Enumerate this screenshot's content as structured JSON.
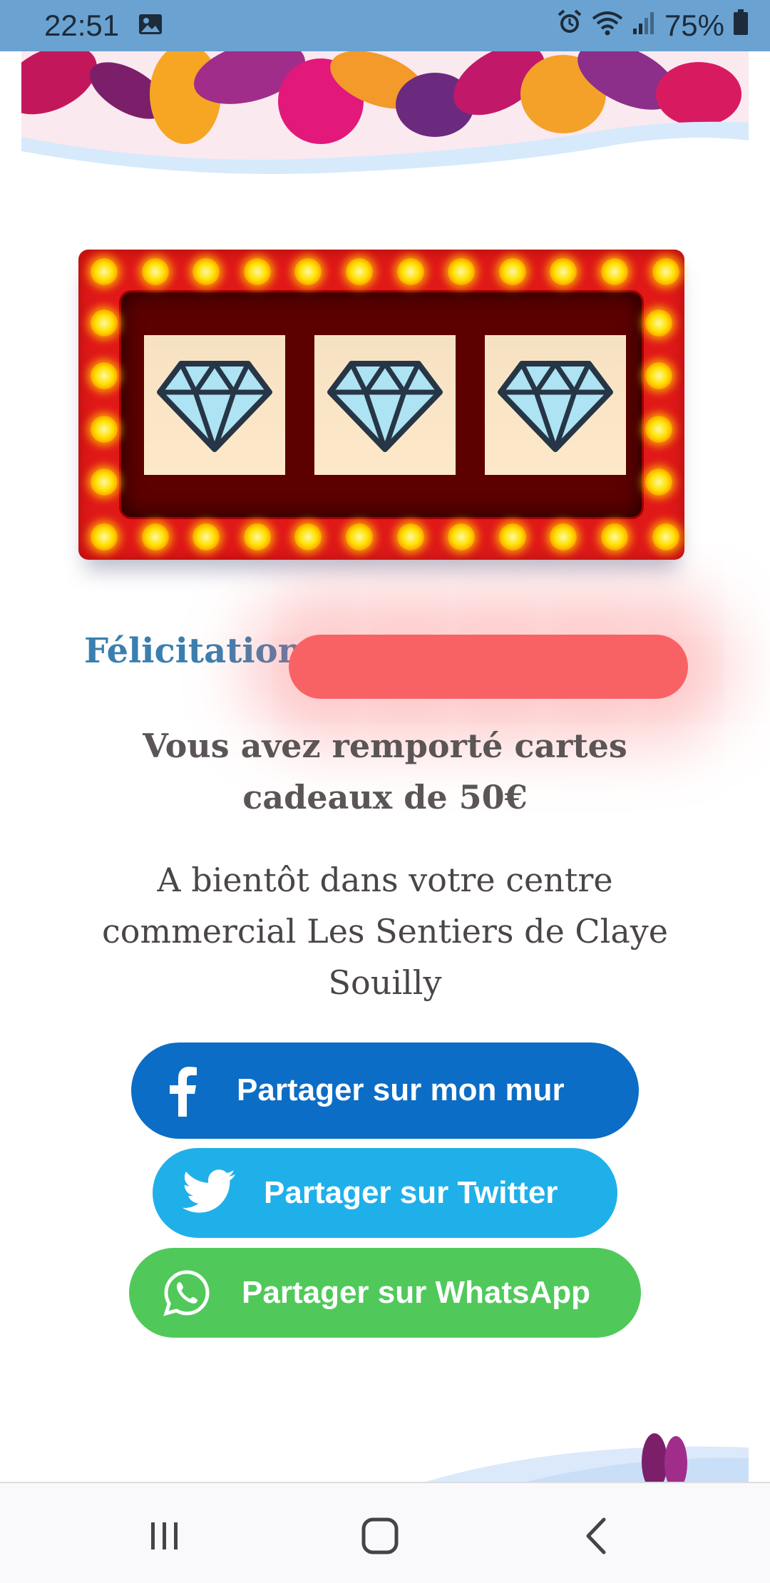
{
  "status_bar": {
    "time": "22:51",
    "battery": "75%",
    "icons": [
      "image-icon",
      "alarm-icon",
      "wifi-icon",
      "signal-icon",
      "battery-icon"
    ]
  },
  "slot_machine": {
    "symbols": [
      "diamond-icon",
      "diamond-icon",
      "diamond-icon"
    ]
  },
  "result": {
    "congrats": "Félicitations",
    "prize_text": "Vous avez remporté cartes cadeaux de 50€",
    "closing_text": "A bientôt dans votre centre commercial Les Sentiers de Claye Souilly"
  },
  "share": {
    "facebook_label": "Partager sur mon mur",
    "twitter_label": "Partager sur Twitter",
    "whatsapp_label": "Partager sur WhatsApp"
  },
  "colors": {
    "facebook": "#0b6dc6",
    "twitter": "#1fb0ea",
    "whatsapp": "#50c95a",
    "status_bar": "#6aa3d2",
    "congrats_text": "#3a7fb0",
    "redaction": "#f96265"
  },
  "nav_bar": {
    "buttons": [
      "recent-apps-icon",
      "home-icon",
      "back-icon"
    ]
  }
}
